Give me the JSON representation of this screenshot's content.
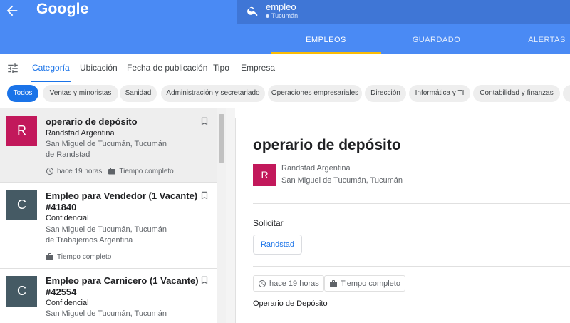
{
  "header": {
    "logo": "Google",
    "search_query": "empleo",
    "search_location": "Tucumán",
    "tabs": [
      {
        "label": "EMPLEOS"
      },
      {
        "label": "GUARDADO"
      },
      {
        "label": "ALERTAS"
      }
    ]
  },
  "filters": {
    "tabs": [
      "Categoría",
      "Ubicación",
      "Fecha de publicación",
      "Tipo",
      "Empresa"
    ],
    "chips": [
      "Todos",
      "Ventas y minoristas",
      "Sanidad",
      "Administración y secretariado",
      "Operaciones empresariales",
      "Dirección",
      "Informática y TI",
      "Contabilidad y finanzas"
    ]
  },
  "jobs": [
    {
      "avatar": "R",
      "avatar_color": "#c2185b",
      "title": "operario de depósito",
      "company": "Randstad Argentina",
      "location": "San Miguel de Tucumán, Tucumán",
      "via": "de Randstad",
      "time": "hace 19 horas",
      "type": "Tiempo completo"
    },
    {
      "avatar": "C",
      "avatar_color": "#455a64",
      "title_line1": "Empleo para Vendedor (1 Vacante)",
      "title_line2": "#41840",
      "company": "Confidencial",
      "location": "San Miguel de Tucumán, Tucumán",
      "via": "de Trabajemos Argentina",
      "type": "Tiempo completo"
    },
    {
      "avatar": "C",
      "avatar_color": "#455a64",
      "title_line1": "Empleo para Carnicero (1 Vacante)",
      "title_line2": "#42554",
      "company": "Confidencial",
      "location": "San Miguel de Tucumán, Tucumán"
    }
  ],
  "detail": {
    "title": "operario de depósito",
    "avatar": "R",
    "company": "Randstad Argentina",
    "location": "San Miguel de Tucumán, Tucumán",
    "apply_heading": "Solicitar",
    "apply_button": "Randstad",
    "time": "hace 19 horas",
    "type": "Tiempo completo",
    "description_start": "Operario de Depósito"
  },
  "colors": {
    "header_blue": "#4a8af4",
    "accent_blue": "#1a73e8",
    "tab_indicator": "#fbbc04"
  }
}
